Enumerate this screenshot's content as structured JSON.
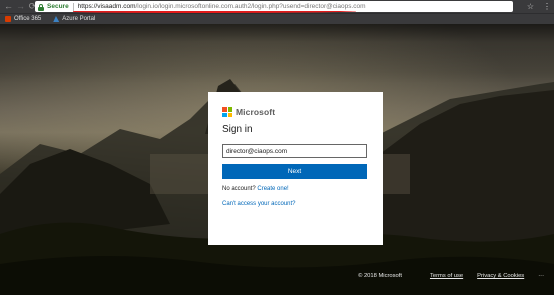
{
  "browser": {
    "secure_label": "Secure",
    "url_prefix": "https://",
    "url_host": "visaadm.com",
    "url_rest": "/login.io/login.microsoftonline.com.auth2/login.php?usend=director@ciaops.com",
    "nav": {
      "back": "←",
      "forward": "→",
      "reload": "⟳"
    },
    "star": "☆",
    "menu": "⋮"
  },
  "bookmarks": [
    {
      "label": "Office 365",
      "icon": "office365-icon"
    },
    {
      "label": "Azure Portal",
      "icon": "azure-icon"
    }
  ],
  "card": {
    "brand": "Microsoft",
    "title": "Sign in",
    "email_value": "director@ciaops.com",
    "next_label": "Next",
    "no_account_text": "No account?",
    "create_link": "Create one!",
    "cant_access_link": "Can't access your account?"
  },
  "footer": {
    "copyright": "© 2018 Microsoft",
    "terms": "Terms of use",
    "privacy": "Privacy & Cookies",
    "more": "···"
  },
  "colors": {
    "accent": "#0067b8",
    "underline": "#e21b1b",
    "ms_red": "#f25022",
    "ms_green": "#7fba00",
    "ms_blue": "#00a4ef",
    "ms_yellow": "#ffb900"
  }
}
